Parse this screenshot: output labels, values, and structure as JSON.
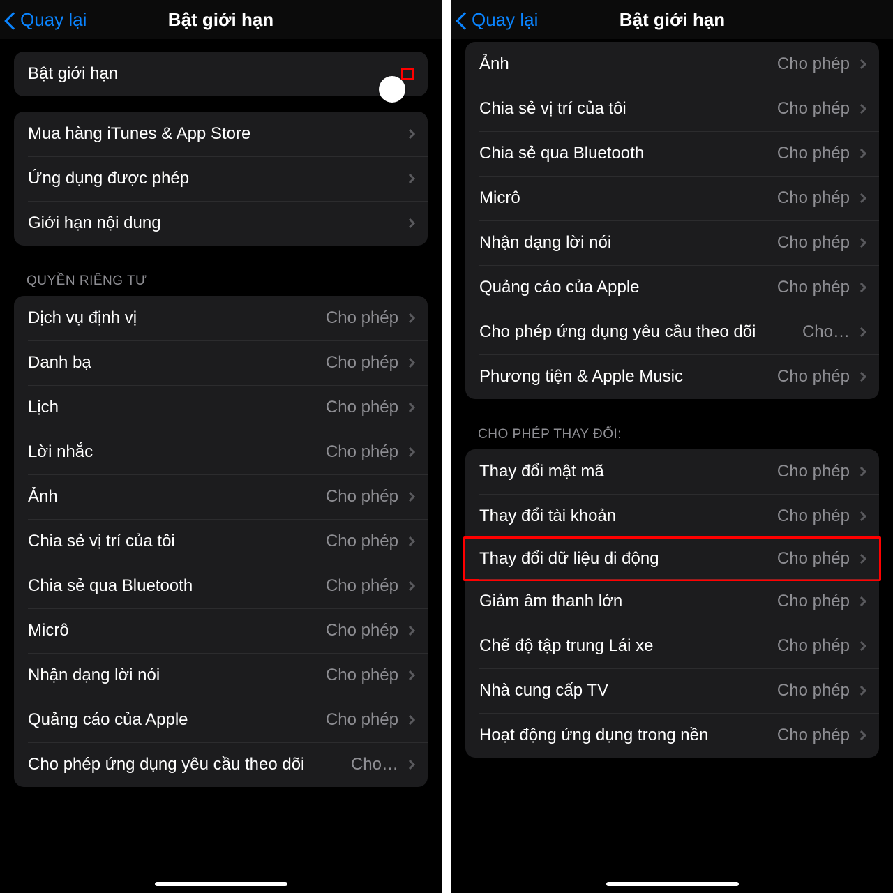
{
  "left": {
    "nav": {
      "back": "Quay lại",
      "title": "Bật giới hạn"
    },
    "toggle": {
      "label": "Bật giới hạn",
      "on": true
    },
    "main_items": [
      {
        "label": "Mua hàng iTunes & App Store"
      },
      {
        "label": "Ứng dụng được phép"
      },
      {
        "label": "Giới hạn nội dung"
      }
    ],
    "privacy_header": "QUYỀN RIÊNG TƯ",
    "privacy_items": [
      {
        "label": "Dịch vụ định vị",
        "value": "Cho phép"
      },
      {
        "label": "Danh bạ",
        "value": "Cho phép"
      },
      {
        "label": "Lịch",
        "value": "Cho phép"
      },
      {
        "label": "Lời nhắc",
        "value": "Cho phép"
      },
      {
        "label": "Ảnh",
        "value": "Cho phép"
      },
      {
        "label": "Chia sẻ vị trí của tôi",
        "value": "Cho phép"
      },
      {
        "label": "Chia sẻ qua Bluetooth",
        "value": "Cho phép"
      },
      {
        "label": "Micrô",
        "value": "Cho phép"
      },
      {
        "label": "Nhận dạng lời nói",
        "value": "Cho phép"
      },
      {
        "label": "Quảng cáo của Apple",
        "value": "Cho phép"
      },
      {
        "label": "Cho phép ứng dụng yêu cầu theo dõi",
        "value": "Cho…"
      }
    ]
  },
  "right": {
    "nav": {
      "back": "Quay lại",
      "title": "Bật giới hạn"
    },
    "privacy_items": [
      {
        "label": "Ảnh",
        "value": "Cho phép"
      },
      {
        "label": "Chia sẻ vị trí của tôi",
        "value": "Cho phép"
      },
      {
        "label": "Chia sẻ qua Bluetooth",
        "value": "Cho phép"
      },
      {
        "label": "Micrô",
        "value": "Cho phép"
      },
      {
        "label": "Nhận dạng lời nói",
        "value": "Cho phép"
      },
      {
        "label": "Quảng cáo của Apple",
        "value": "Cho phép"
      },
      {
        "label": "Cho phép ứng dụng yêu cầu theo dõi",
        "value": "Cho…"
      },
      {
        "label": "Phương tiện & Apple Music",
        "value": "Cho phép"
      }
    ],
    "changes_header": "CHO PHÉP THAY ĐỔI:",
    "changes_items": [
      {
        "label": "Thay đổi mật mã",
        "value": "Cho phép"
      },
      {
        "label": "Thay đổi tài khoản",
        "value": "Cho phép"
      },
      {
        "label": "Thay đổi dữ liệu di động",
        "value": "Cho phép",
        "highlight": true
      },
      {
        "label": "Giảm âm thanh lớn",
        "value": "Cho phép"
      },
      {
        "label": "Chế độ tập trung Lái xe",
        "value": "Cho phép"
      },
      {
        "label": "Nhà cung cấp TV",
        "value": "Cho phép"
      },
      {
        "label": "Hoạt động ứng dụng trong nền",
        "value": "Cho phép"
      }
    ]
  }
}
